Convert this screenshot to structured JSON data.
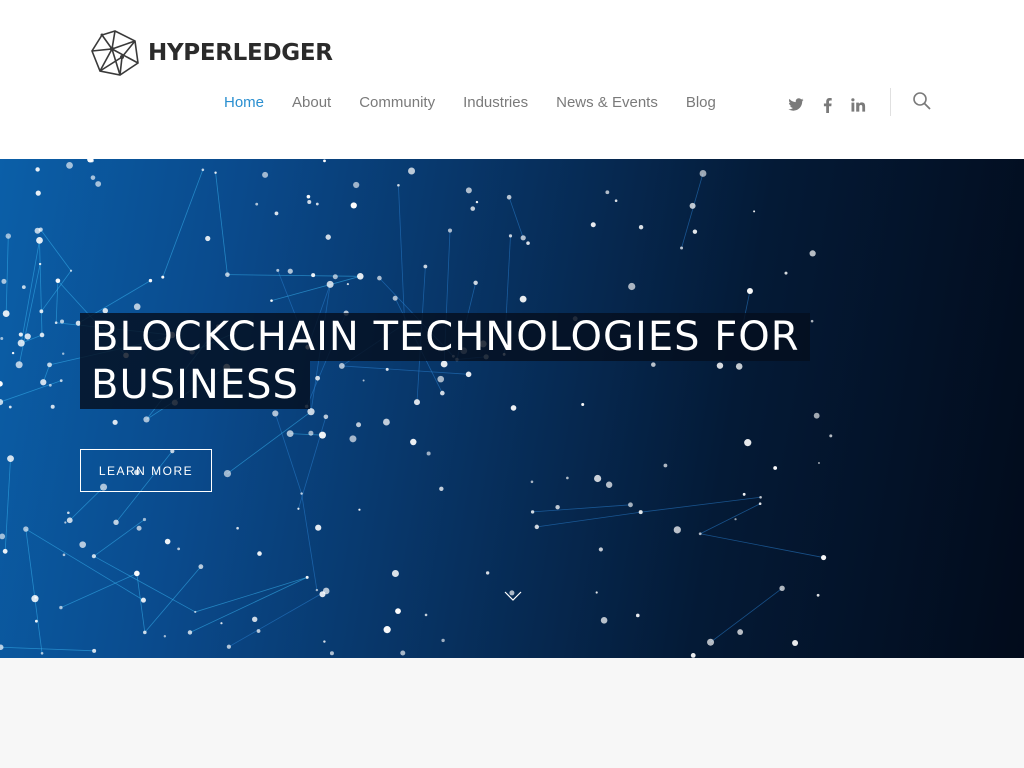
{
  "header": {
    "logo_text": "HYPERLEDGER",
    "nav": [
      {
        "label": "Home"
      },
      {
        "label": "About"
      },
      {
        "label": "Community"
      },
      {
        "label": "Industries"
      },
      {
        "label": "News & Events"
      },
      {
        "label": "Blog"
      }
    ],
    "social": [
      "twitter-icon",
      "facebook-icon",
      "linkedin-icon"
    ],
    "search_icon": "search-icon"
  },
  "hero": {
    "title_line1": "BLOCKCHAIN TECHNOLOGIES FOR",
    "title_line2": "BUSINESS",
    "cta_label": "LEARN MORE",
    "scroll_icon": "chevron-down-icon"
  },
  "colors": {
    "accent": "#2a8fd0",
    "nav_text": "#7a7a7a",
    "hero_dark": "#020b1b",
    "hero_blue": "#0b5fa8"
  }
}
